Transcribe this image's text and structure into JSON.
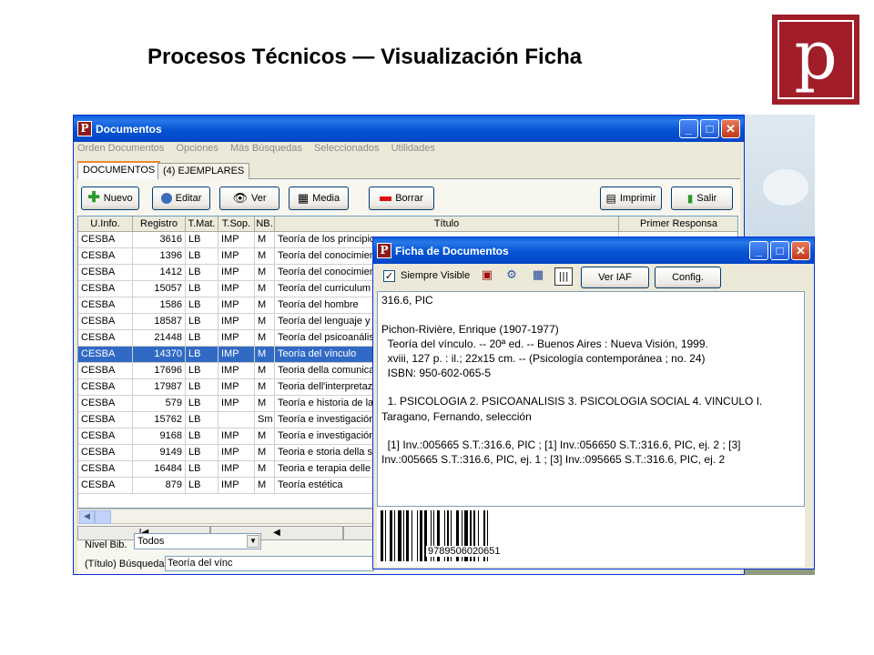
{
  "slide": {
    "title": "Procesos Técnicos — Visualización Ficha",
    "logo_letter": "p"
  },
  "colors": {
    "accent": "#a11d2a",
    "titlebar": "#0554d4",
    "selection": "#316ac5"
  },
  "documentos": {
    "title": "Documentos",
    "menu": [
      "Orden Documentos",
      "Opciones",
      "Más Búsquedas",
      "Seleccionados",
      "Utilidades"
    ],
    "tabs": [
      "DOCUMENTOS",
      "(4) EJEMPLARES"
    ],
    "toolbar": {
      "nuevo": "Nuevo",
      "editar": "Editar",
      "ver": "Ver",
      "media": "Media",
      "borrar": "Borrar",
      "imprimir": "Imprimir",
      "salir": "Salir"
    },
    "columns": [
      "U.Info.",
      "Registro",
      "T.Mat.",
      "T.Sop.",
      "NB.",
      "Título",
      "Primer Responsa"
    ],
    "rows": [
      {
        "uinfo": "CESBA",
        "registro": "3616",
        "tmat": "LB",
        "tsop": "IMP",
        "nb": "M",
        "titulo": "Teoría de los principios",
        "resp": ""
      },
      {
        "uinfo": "CESBA",
        "registro": "1396",
        "tmat": "LB",
        "tsop": "IMP",
        "nb": "M",
        "titulo": "Teoría del conocimiento",
        "resp": ""
      },
      {
        "uinfo": "CESBA",
        "registro": "1412",
        "tmat": "LB",
        "tsop": "IMP",
        "nb": "M",
        "titulo": "Teoría del conocimiento",
        "resp": ""
      },
      {
        "uinfo": "CESBA",
        "registro": "15057",
        "tmat": "LB",
        "tsop": "IMP",
        "nb": "M",
        "titulo": "Teoría del curriculum",
        "resp": ""
      },
      {
        "uinfo": "CESBA",
        "registro": "1586",
        "tmat": "LB",
        "tsop": "IMP",
        "nb": "M",
        "titulo": "Teoría del hombre",
        "resp": ""
      },
      {
        "uinfo": "CESBA",
        "registro": "18587",
        "tmat": "LB",
        "tsop": "IMP",
        "nb": "M",
        "titulo": "Teoría del lenguaje y l",
        "resp": ""
      },
      {
        "uinfo": "CESBA",
        "registro": "21448",
        "tmat": "LB",
        "tsop": "IMP",
        "nb": "M",
        "titulo": "Teoría del psicoanálisis",
        "resp": ""
      },
      {
        "uinfo": "CESBA",
        "registro": "14370",
        "tmat": "LB",
        "tsop": "IMP",
        "nb": "M",
        "titulo": "Teoría del vínculo",
        "resp": "",
        "selected": true
      },
      {
        "uinfo": "CESBA",
        "registro": "17696",
        "tmat": "LB",
        "tsop": "IMP",
        "nb": "M",
        "titulo": "Teoria della comunicazione",
        "resp": ""
      },
      {
        "uinfo": "CESBA",
        "registro": "17987",
        "tmat": "LB",
        "tsop": "IMP",
        "nb": "M",
        "titulo": "Teoria dell'interpretazione",
        "resp": ""
      },
      {
        "uinfo": "CESBA",
        "registro": "579",
        "tmat": "LB",
        "tsop": "IMP",
        "nb": "M",
        "titulo": "Teoría e historia de la",
        "resp": ""
      },
      {
        "uinfo": "CESBA",
        "registro": "15762",
        "tmat": "LB",
        "tsop": "",
        "nb": "Sm",
        "titulo": "Teoría e investigación",
        "resp": ""
      },
      {
        "uinfo": "CESBA",
        "registro": "9168",
        "tmat": "LB",
        "tsop": "IMP",
        "nb": "M",
        "titulo": "Teoría e investigación",
        "resp": ""
      },
      {
        "uinfo": "CESBA",
        "registro": "9149",
        "tmat": "LB",
        "tsop": "IMP",
        "nb": "M",
        "titulo": "Teoria e storia della st",
        "resp": ""
      },
      {
        "uinfo": "CESBA",
        "registro": "16484",
        "tmat": "LB",
        "tsop": "IMP",
        "nb": "M",
        "titulo": "Teoria e terapia delle",
        "resp": ""
      },
      {
        "uinfo": "CESBA",
        "registro": "879",
        "tmat": "LB",
        "tsop": "IMP",
        "nb": "M",
        "titulo": "Teoría estética",
        "resp": ""
      }
    ],
    "nav": {
      "first": "I◀",
      "prev": "◀"
    },
    "nivel_bib_label": "Nivel Bib.",
    "nivel_bib_value": "Todos",
    "busqueda_label": "(Título) Búsqueda",
    "busqueda_value": "Teoría del vínc"
  },
  "ficha": {
    "title": "Ficha de Documentos",
    "siempre_visible": "Siempre Visible",
    "ver_iaf": "Ver IAF",
    "config": "Config.",
    "lines": [
      "316.6, PIC",
      "",
      "Pichon-Rivière, Enrique (1907-1977)",
      "  Teoría del vínculo. -- 20ª ed. -- Buenos Aires : Nueva Visión, 1999.",
      "  xviii, 127 p. : il.; 22x15 cm. -- (Psicología contemporánea ; no. 24)",
      "  ISBN: 950-602-065-5",
      "",
      "  1. PSICOLOGIA 2. PSICOANALISIS 3. PSICOLOGIA SOCIAL 4. VINCULO I.",
      "Taragano, Fernando, selección",
      "",
      "  [1] Inv.:005665 S.T.:316.6, PIC ; [1] Inv.:056650 S.T.:316.6, PIC, ej. 2 ; [3]",
      "Inv.:005665 S.T.:316.6, PIC, ej. 1 ; [3] Inv.:095665 S.T.:316.6, PIC, ej. 2"
    ],
    "barcode_number": "9789506020651"
  }
}
